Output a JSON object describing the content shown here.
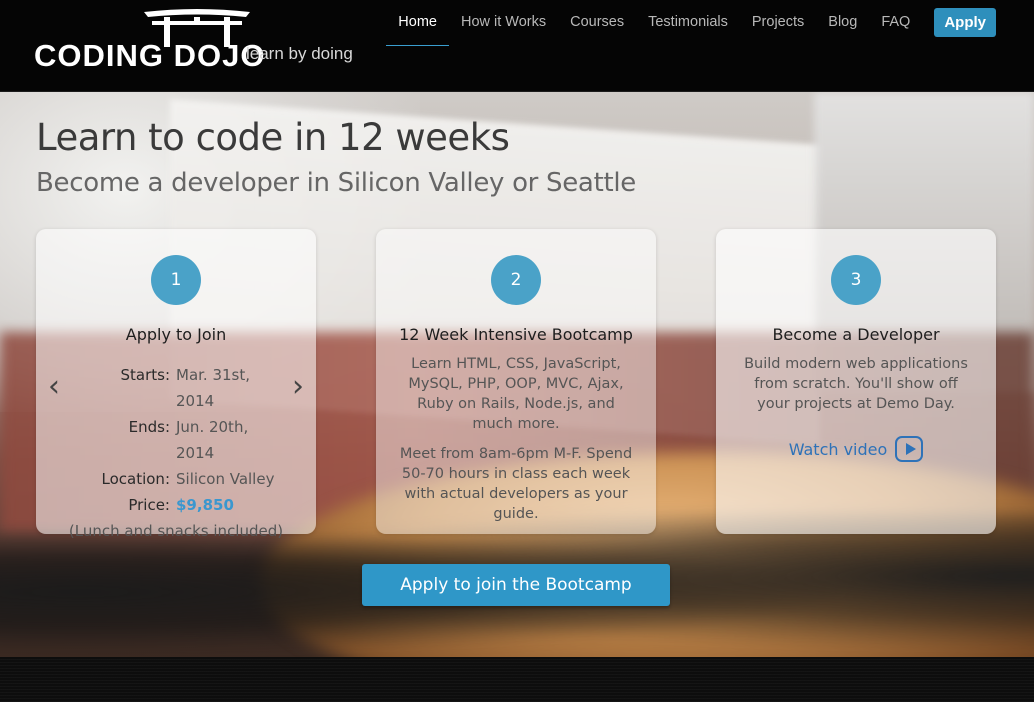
{
  "header": {
    "logo_text": "CODING DOJO",
    "tagline": "learn by doing",
    "nav": [
      {
        "label": "Home",
        "active": true
      },
      {
        "label": "How it Works"
      },
      {
        "label": "Courses"
      },
      {
        "label": "Testimonials"
      },
      {
        "label": "Projects"
      },
      {
        "label": "Blog"
      },
      {
        "label": "FAQ"
      }
    ],
    "apply_label": "Apply"
  },
  "hero": {
    "headline": "Learn to code in 12 weeks",
    "subheadline": "Become a developer in Silicon Valley or Seattle",
    "cards": [
      {
        "number": "1",
        "title": "Apply to Join",
        "details": [
          {
            "label": "Starts:",
            "value": "Mar. 31st, 2014"
          },
          {
            "label": "Ends:",
            "value": "Jun. 20th, 2014"
          },
          {
            "label": "Location:",
            "value": "Silicon Valley"
          },
          {
            "label": "Price:",
            "value": "$9,850"
          }
        ],
        "note": "(Lunch and snacks included)"
      },
      {
        "number": "2",
        "title": "12 Week Intensive Bootcamp",
        "paragraphs": [
          "Learn HTML, CSS, JavaScript, MySQL, PHP, OOP, MVC, Ajax, Ruby on Rails, Node.js, and much more.",
          "Meet from 8am-6pm M-F. Spend 50-70 hours in class each week with actual developers as your guide."
        ]
      },
      {
        "number": "3",
        "title": "Become a Developer",
        "paragraphs": [
          "Build modern web applications from scratch. You'll show off your projects at Demo Day."
        ],
        "link_label": "Watch video"
      }
    ],
    "cta_label": "Apply to join the Bootcamp"
  },
  "icons": {
    "prev": "chevron-left-icon",
    "next": "chevron-right-icon",
    "play": "play-icon"
  },
  "colors": {
    "accent": "#2f97c8",
    "link": "#2e72b8",
    "price": "#3a97cf"
  }
}
